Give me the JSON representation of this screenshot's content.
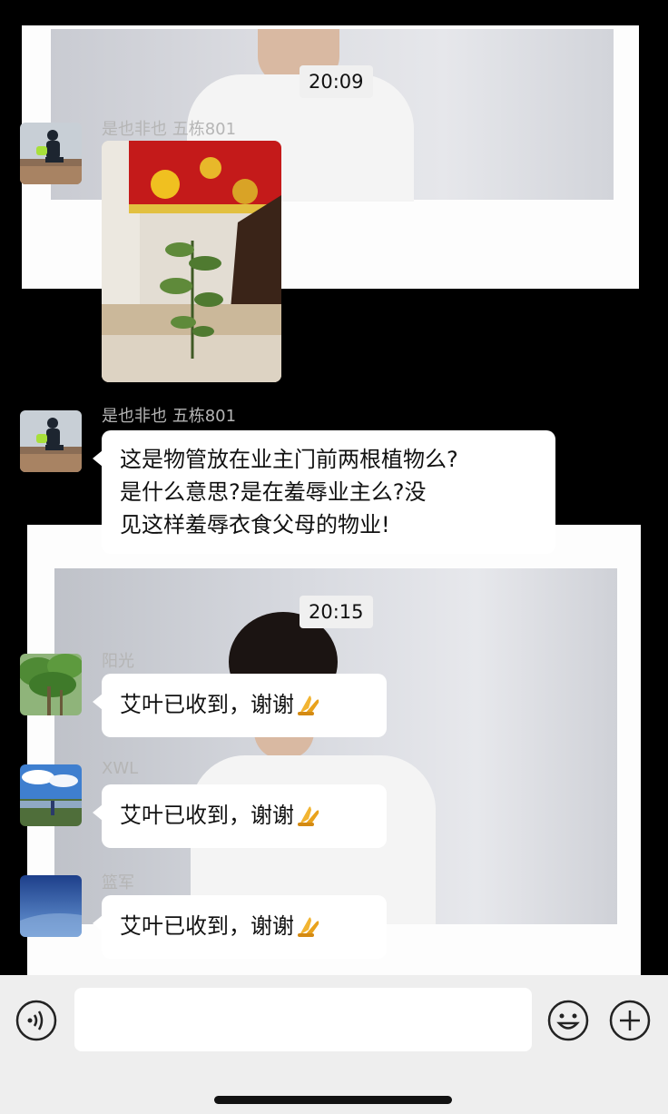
{
  "timestamps": [
    "20:09",
    "20:15"
  ],
  "messages": [
    {
      "sender": "是也非也  五栋801",
      "type": "image"
    },
    {
      "sender": "是也非也  五栋801",
      "type": "text",
      "lines": [
        "这是物管放在业主门前两根植物么?",
        "是什么意思?是在羞辱业主么?没",
        "见这样羞辱衣食父母的物业!"
      ]
    },
    {
      "sender": "阳光",
      "type": "text",
      "text": "艾叶已收到，谢谢"
    },
    {
      "sender": "XWL",
      "type": "text",
      "text": "艾叶已收到，谢谢"
    },
    {
      "sender": "篮军",
      "type": "text",
      "text": "艾叶已收到，谢谢"
    }
  ],
  "icons": {
    "voice": "voice-icon",
    "emoji": "emoji-icon",
    "plus": "plus-icon",
    "reaction": "praying-hands-icon"
  },
  "colors": {
    "background": "#000000",
    "bubble": "#ffffff",
    "sender_name": "#b5b5b5",
    "input_bar": "#eeeeee"
  }
}
